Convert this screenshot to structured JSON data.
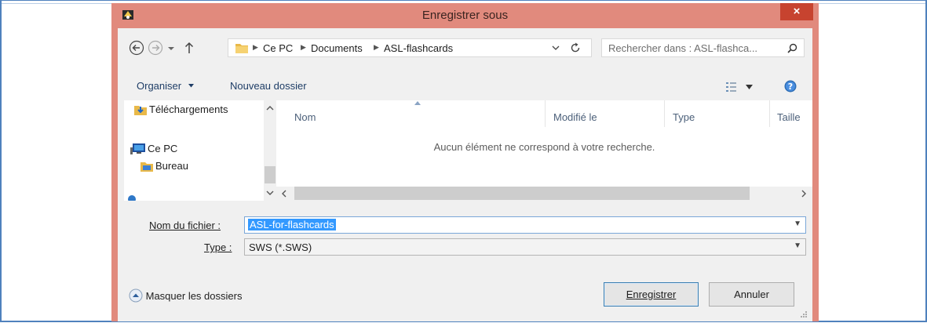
{
  "window": {
    "title": "Enregistrer sous",
    "close_glyph": "×",
    "accent": "#e18a7d",
    "close_color": "#c7432f"
  },
  "navigation": {
    "back_icon": "back-arrow-icon",
    "forward_icon": "forward-arrow-icon",
    "up_icon": "up-arrow-icon",
    "refresh_icon": "refresh-icon",
    "breadcrumbs": [
      "Ce PC",
      "Documents",
      "ASL-flashcards"
    ],
    "search_placeholder": "Rechercher dans : ASL-flashca..."
  },
  "toolbar": {
    "organize_label": "Organiser",
    "new_folder_label": "Nouveau dossier"
  },
  "sidebar": {
    "items": [
      {
        "label": "Téléchargements",
        "icon": "downloads-folder-icon"
      },
      {
        "label": "Ce PC",
        "icon": "computer-icon"
      },
      {
        "label": "Bureau",
        "icon": "desktop-folder-icon"
      }
    ]
  },
  "file_list": {
    "columns": [
      "Nom",
      "Modifié le",
      "Type",
      "Taille"
    ],
    "empty_message": "Aucun élément ne correspond à votre recherche."
  },
  "form": {
    "filename_label": "Nom du fichier :",
    "filename_value": "ASL-for-flashcards",
    "type_label": "Type :",
    "type_value": "SWS (*.SWS)"
  },
  "footer": {
    "hide_folders_label": "Masquer les dossiers",
    "save_label": "Enregistrer",
    "cancel_label": "Annuler"
  }
}
